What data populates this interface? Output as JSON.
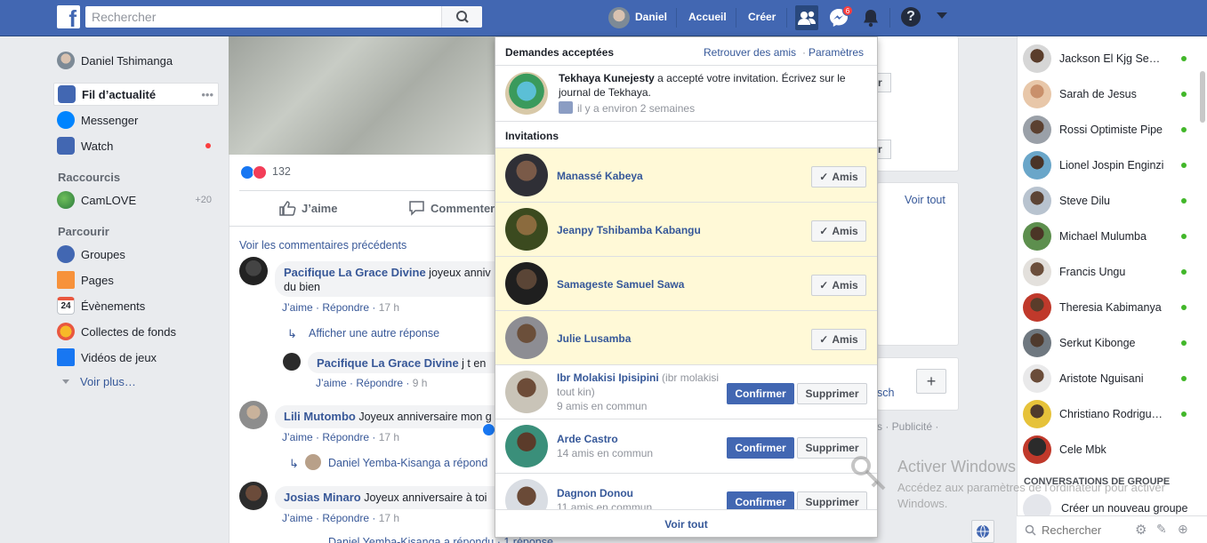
{
  "colors": {
    "brand": "#4267b2",
    "link": "#365899",
    "accepted_bg": "#fff9d7",
    "online": "#42b72a",
    "badge": "#fa3e3e"
  },
  "topbar": {
    "logo": "f",
    "search_placeholder": "Rechercher",
    "profile_name": "Daniel",
    "home": "Accueil",
    "create": "Créer",
    "messages_badge": "6",
    "icons": [
      "friends-icon",
      "messenger-icon",
      "notifications-icon",
      "help-icon",
      "caret-down-icon"
    ]
  },
  "left_nav": {
    "user": "Daniel Tshimanga",
    "items": [
      {
        "label": "Fil d’actualité",
        "more": "•••"
      },
      {
        "label": "Messenger"
      },
      {
        "label": "Watch"
      }
    ],
    "shortcuts_title": "Raccourcis",
    "shortcuts": [
      {
        "label": "CamLOVE",
        "count": "+20"
      }
    ],
    "explore_title": "Parcourir",
    "explore": [
      {
        "label": "Groupes"
      },
      {
        "label": "Pages"
      },
      {
        "label": "Évènements",
        "day": "24"
      },
      {
        "label": "Collectes de fonds"
      },
      {
        "label": "Vidéos de jeux"
      }
    ],
    "see_more": "Voir plus…"
  },
  "post": {
    "reactions_count": "132",
    "like_label": "J’aime",
    "comment_label": "Commenter",
    "previous_comments": "Voir les commentaires précédents",
    "comments": [
      {
        "name": "Pacifique La Grace Divine",
        "text": "joyeux anniv",
        "text2": "du bien",
        "like": "J’aime",
        "reply": "Répondre",
        "time": "17 h"
      },
      {
        "more_replies": "Afficher une autre réponse"
      },
      {
        "name": "Pacifique La Grace Divine",
        "text": "j t en",
        "like": "J’aime",
        "reply": "Répondre",
        "time": "9 h"
      },
      {
        "name": "Lili Mutombo",
        "text": "Joyeux anniversaire mon g",
        "like": "J’aime",
        "reply": "Répondre",
        "time": "17 h"
      },
      {
        "reply_preview": "Daniel Yemba-Kisanga a répond"
      },
      {
        "name": "Josias Minaro",
        "text": "Joyeux anniversaire à toi",
        "like": "J’aime",
        "reply": "Répondre",
        "time": "17 h"
      },
      {
        "reply_preview": "Daniel Yemba-Kisanga a répondu · 1 réponse"
      }
    ]
  },
  "middle": {
    "see_all": "Voir tout",
    "partial_r1": "r",
    "partial_r2": "r",
    "partial_sch": "sch",
    "plus": "+",
    "footer": "s · Publicité ·"
  },
  "dropdown": {
    "accepted_title": "Demandes acceptées",
    "find_friends": "Retrouver des amis",
    "dot": "·",
    "settings": "Paramètres",
    "accepted_item": {
      "name": "Tekhaya Kunejesty",
      "text": "a accepté votre invitation. Écrivez sur le",
      "text2": "journal de Tekhaya.",
      "time": "il y a environ 2 semaines"
    },
    "invitations_title": "Invitations",
    "friends": [
      {
        "name": "Manassé Kabeya",
        "button": "Amis"
      },
      {
        "name": "Jeanpy Tshibamba Kabangu",
        "button": "Amis"
      },
      {
        "name": "Samageste Samuel Sawa",
        "button": "Amis"
      },
      {
        "name": "Julie Lusamba",
        "button": "Amis"
      }
    ],
    "requests": [
      {
        "name": "Ibr Molakisi Ipisipini",
        "alias": "(ibr molakisi",
        "alias2": "tout kin)",
        "mutual": "9 amis en commun",
        "confirm": "Confirmer",
        "delete": "Supprimer"
      },
      {
        "name": "Arde Castro",
        "mutual": "14 amis en commun",
        "confirm": "Confirmer",
        "delete": "Supprimer"
      },
      {
        "name": "Dagnon Donou",
        "mutual": "11 amis en commun",
        "confirm": "Confirmer",
        "delete": "Supprimer"
      }
    ],
    "see_all": "Voir tout"
  },
  "chat": {
    "contacts": [
      {
        "name": "Jackson El Kjg Semete"
      },
      {
        "name": "Sarah de Jesus"
      },
      {
        "name": "Rossi Optimiste Pipe"
      },
      {
        "name": "Lionel Jospin Enginzi"
      },
      {
        "name": "Steve Dilu"
      },
      {
        "name": "Michael Mulumba"
      },
      {
        "name": "Francis Ungu"
      },
      {
        "name": "Theresia Kabimanya"
      },
      {
        "name": "Serkut Kibonge"
      },
      {
        "name": "Aristote Nguisani"
      },
      {
        "name": "Christiano Rodrigue ..."
      },
      {
        "name": "Cele Mbk"
      }
    ],
    "group_title": "CONVERSATIONS DE GROUPE",
    "create_group": "Créer un nouveau groupe",
    "search_placeholder": "Rechercher"
  },
  "watermark": {
    "title": "Activer Windows",
    "sub": "Accédez aux paramètres de l'ordinateur pour activer Windows."
  }
}
